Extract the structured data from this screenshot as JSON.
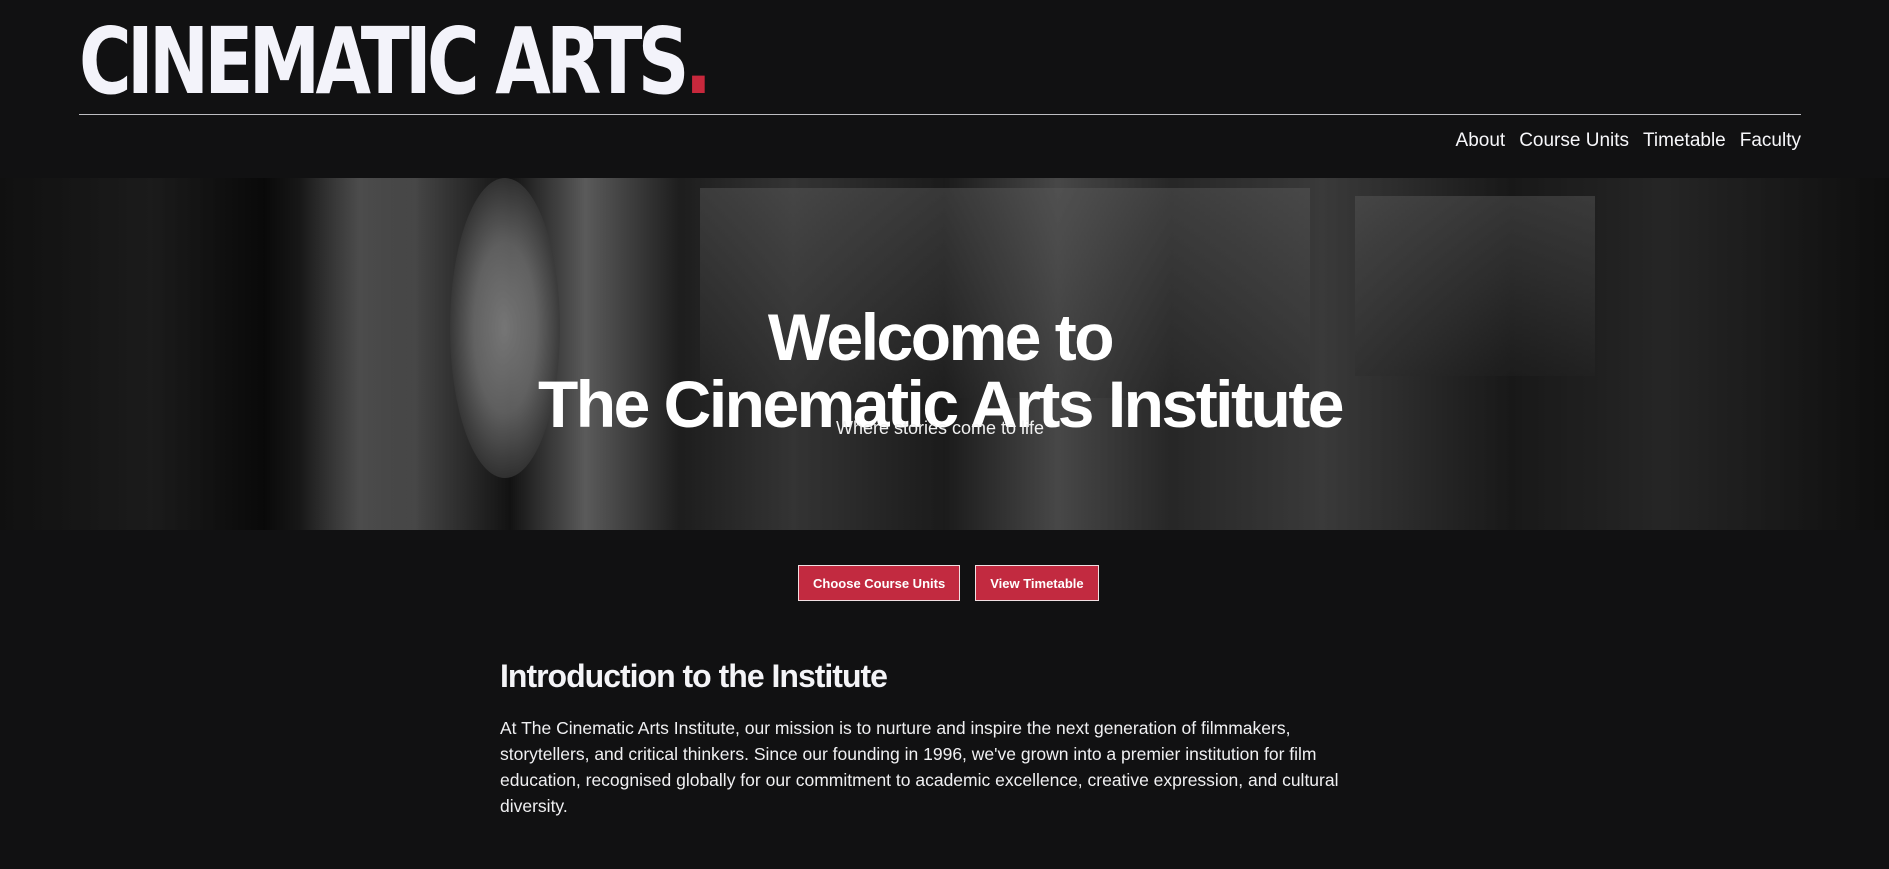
{
  "header": {
    "logo_text": "CINEMATIC ARTS",
    "logo_dot": ".",
    "nav": [
      {
        "label": "About"
      },
      {
        "label": "Course Units"
      },
      {
        "label": "Timetable"
      },
      {
        "label": "Faculty"
      }
    ]
  },
  "hero": {
    "title_line1": "Welcome to",
    "title_line2": "The Cinematic Arts Institute",
    "subtitle": "Where stories come to life"
  },
  "cta": {
    "primary_label": "Choose Course Units",
    "secondary_label": "View Timetable"
  },
  "intro": {
    "title": "Introduction to the Institute",
    "body": "At The Cinematic Arts Institute, our mission is to nurture and inspire the next generation of filmmakers, storytellers, and critical thinkers. Since our founding in 1996, we've grown into a premier institution for film education, recognised globally for our commitment to academic excellence, creative expression, and cultural diversity."
  },
  "colors": {
    "background": "#111112",
    "accent": "#c22a40",
    "text": "#f2f2f5"
  }
}
